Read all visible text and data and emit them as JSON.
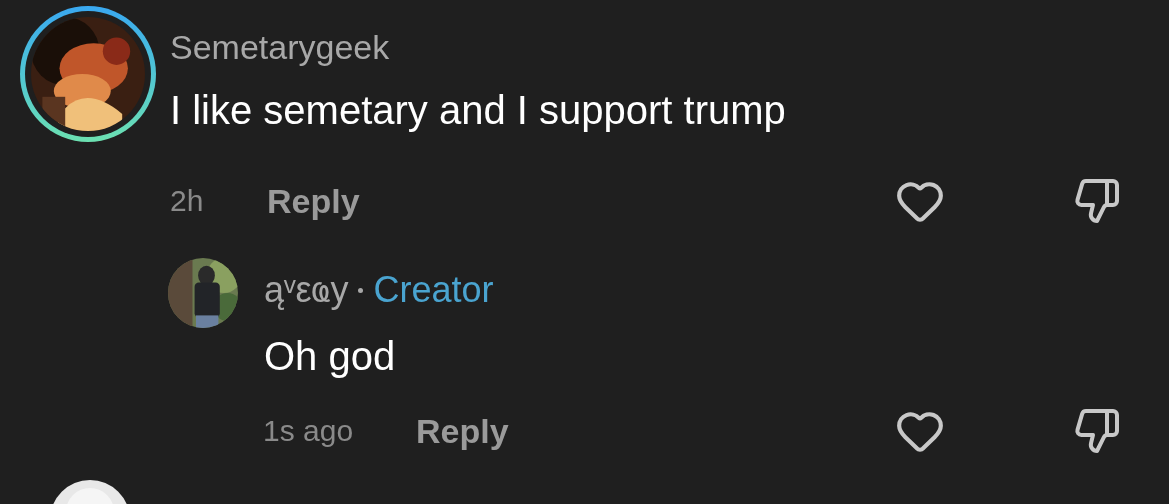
{
  "comments": [
    {
      "username": "Semetarygeek",
      "text": "I like semetary and I support trump",
      "time": "2h",
      "reply_label": "Reply",
      "liked": false,
      "disliked": false,
      "replies": [
        {
          "username": "ąᵛεҩy",
          "badge": "Creator",
          "text": "Oh god",
          "time": "1s ago",
          "reply_label": "Reply",
          "liked": false,
          "disliked": false
        }
      ]
    }
  ]
}
